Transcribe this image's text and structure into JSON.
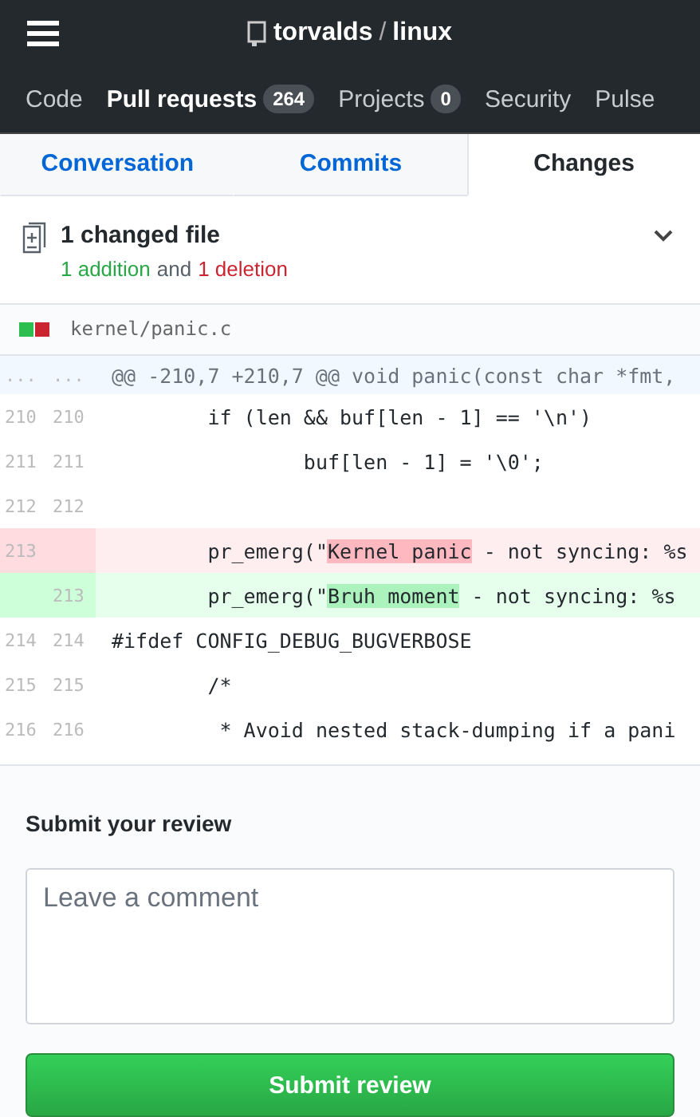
{
  "header": {
    "repo_owner": "torvalds",
    "separator": "/",
    "repo_name": "linux"
  },
  "nav": [
    {
      "label": "Code",
      "selected": false
    },
    {
      "label": "Pull requests",
      "count": "264",
      "selected": true
    },
    {
      "label": "Projects",
      "count": "0",
      "selected": false
    },
    {
      "label": "Security",
      "selected": false
    },
    {
      "label": "Pulse",
      "selected": false
    }
  ],
  "tabs": [
    {
      "label": "Conversation",
      "selected": false
    },
    {
      "label": "Commits",
      "selected": false
    },
    {
      "label": "Changes",
      "selected": true
    }
  ],
  "summary": {
    "title": "1 changed file",
    "additions": "1 addition",
    "joiner": "and",
    "deletions": "1 deletion",
    "expanded": true
  },
  "file": {
    "path": "kernel/panic.c"
  },
  "diff": [
    {
      "kind": "hunk",
      "old": "...",
      "new": "...",
      "code": "@@ -210,7 +210,7 @@ void panic(const char *fmt,"
    },
    {
      "kind": "context",
      "old": "210",
      "new": "210",
      "code": "\tif (len && buf[len - 1] == '\\n')"
    },
    {
      "kind": "context",
      "old": "211",
      "new": "211",
      "code": "\t\tbuf[len - 1] = '\\0';"
    },
    {
      "kind": "context",
      "old": "212",
      "new": "212"
    },
    {
      "kind": "del",
      "old": "213",
      "code": "\tpr_emerg(\"",
      "mark": "Kernel panic",
      "rest": " - not syncing: %s"
    },
    {
      "kind": "add",
      "new": "213",
      "code": "\tpr_emerg(\"",
      "mark": "Bruh moment",
      "rest": " - not syncing: %s"
    },
    {
      "kind": "context",
      "old": "214",
      "new": "214",
      "code": "#ifdef CONFIG_DEBUG_BUGVERBOSE"
    },
    {
      "kind": "context",
      "old": "215",
      "new": "215",
      "code": "\t/*"
    },
    {
      "kind": "context",
      "old": "216",
      "new": "216",
      "code": "\t * Avoid nested stack-dumping if a pani"
    }
  ],
  "review": {
    "heading": "Submit your review",
    "placeholder": "Leave a comment",
    "button": "Submit review"
  }
}
